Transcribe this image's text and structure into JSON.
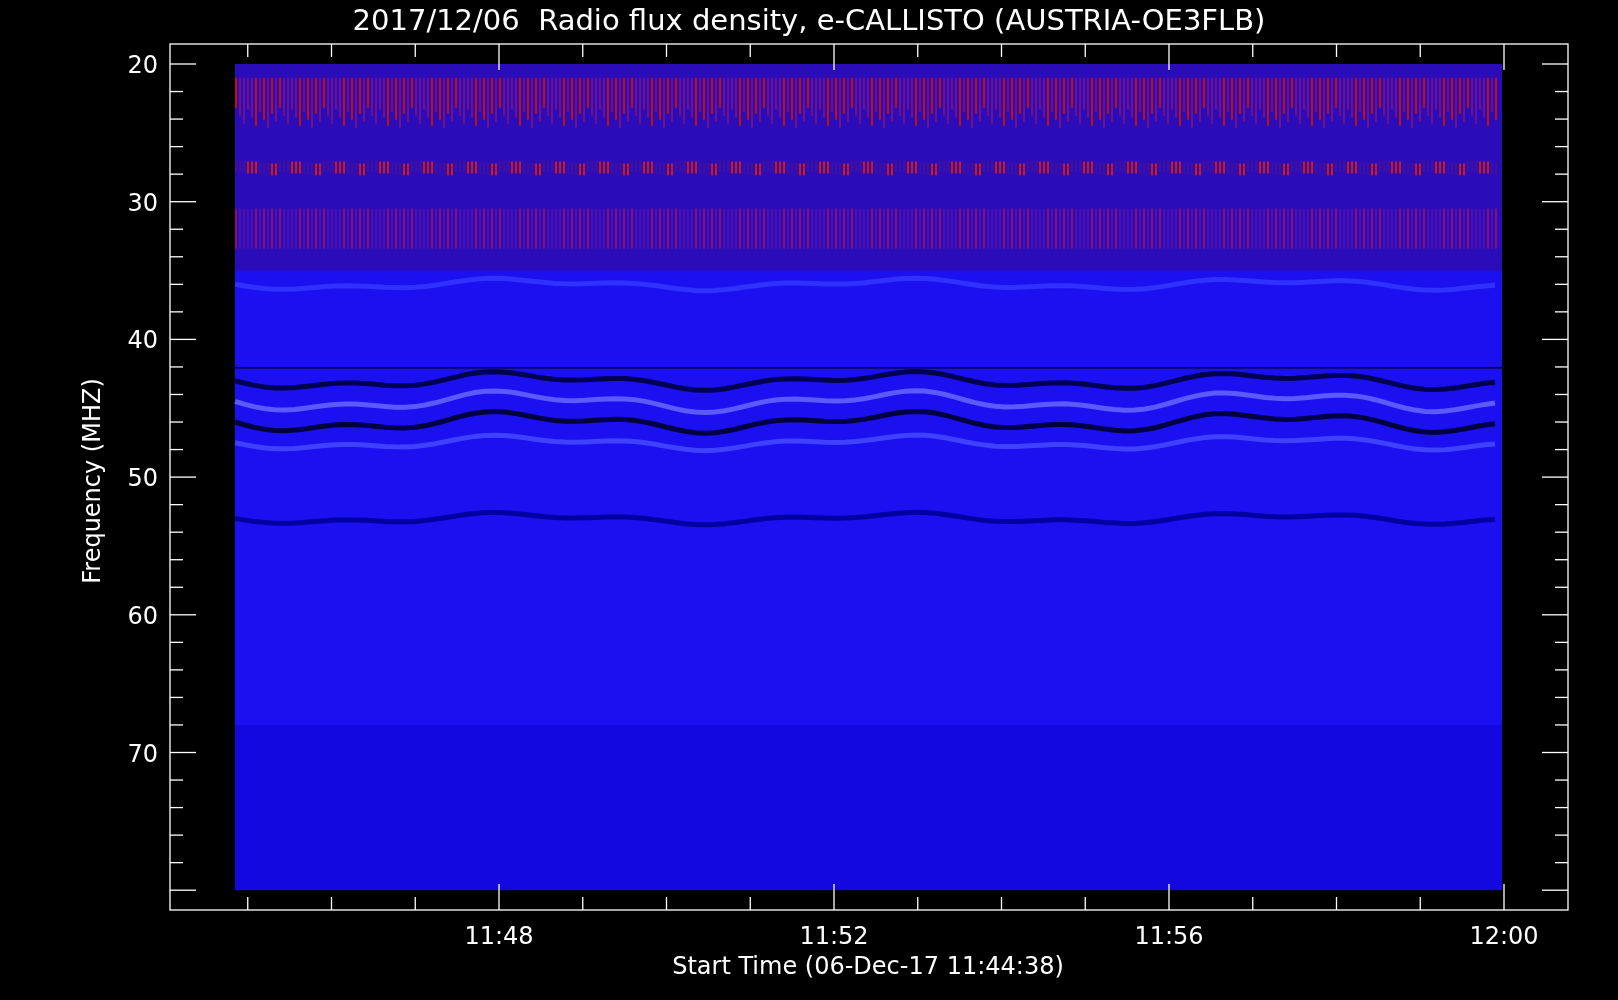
{
  "title": "2017/12/06  Radio flux density, e-CALLISTO (AUSTRIA-OE3FLB)",
  "y_axis": {
    "label": "Frequency (MHZ)",
    "ticks": [
      "20",
      "30",
      "40",
      "50",
      "60",
      "70"
    ]
  },
  "x_axis": {
    "label": "Start Time (06-Dec-17 11:44:38)",
    "ticks": [
      "11:48",
      "11:52",
      "11:56",
      "12:00"
    ]
  }
}
